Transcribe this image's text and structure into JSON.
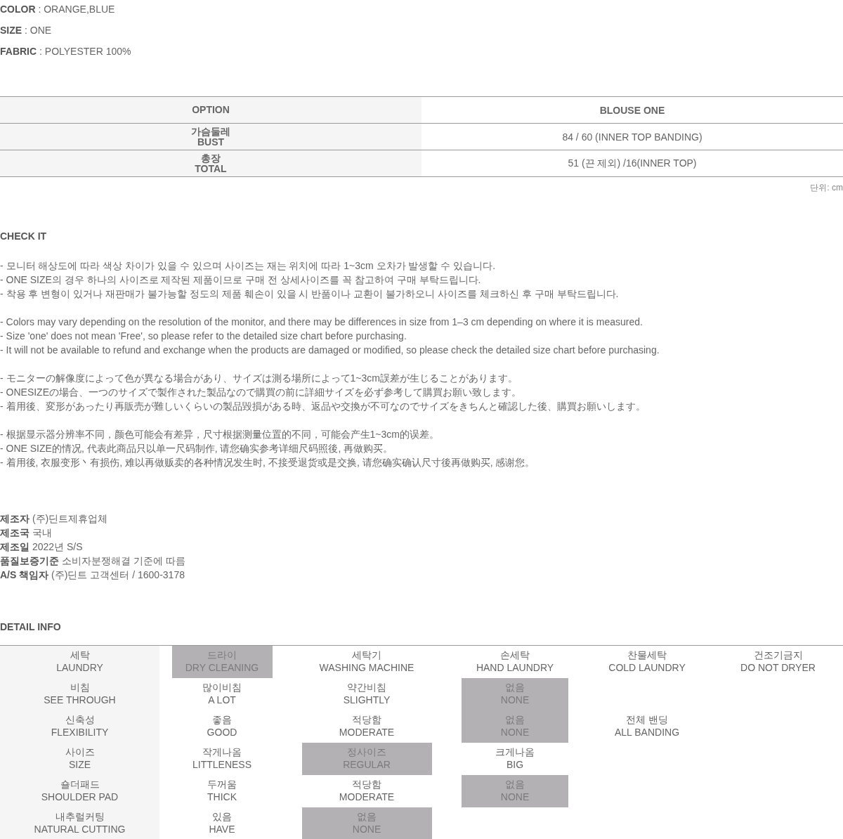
{
  "specs": [
    {
      "label": "COLOR",
      "value": ": ORANGE,BLUE"
    },
    {
      "label": "SIZE",
      "value": ": ONE"
    },
    {
      "label": "FABRIC",
      "value": ": POLYESTER 100%"
    }
  ],
  "size_table": {
    "columns": [
      "OPTION",
      "BLOUSE ONE"
    ],
    "rows": [
      {
        "ko": "가슴둘레",
        "en": "BUST",
        "value": "84 / 60 (INNER TOP BANDING)"
      },
      {
        "ko": "총장",
        "en": "TOTAL",
        "value": "51 (끈 제외) /16(INNER TOP)"
      }
    ],
    "unit": "단위: cm"
  },
  "check_it": {
    "title": "CHECK IT",
    "groups": [
      [
        "- 모니터 해상도에 따라 색상 차이가 있을 수 있으며 사이즈는 재는 위치에 따라 1~3cm 오차가 발생할 수 있습니다.",
        "- ONE SIZE의 경우 하나의 사이즈로 제작된 제품이므로 구매 전 상세사이즈를 꼭 참고하여 구매 부탁드립니다.",
        "- 착용 후 변형이 있거나 재판매가 불가능할 정도의 제품 훼손이 있을 시 반품이나 교환이 불가하오니 사이즈를 체크하신 후 구매 부탁드립니다."
      ],
      [
        "- Colors may vary depending on the resolution of the monitor, and there may be differences in size from 1–3 cm depending on where it is measured.",
        "- Size 'one' does not mean 'Free', so please refer to the detailed size chart before purchasing.",
        "- It will not be available to refund and exchange when the products are damaged or modified, so please check the detailed size chart before purchasing."
      ],
      [
        "- モニターの解像度によって色が異なる場合があり、サイズは測る場所によって1~3cm誤差が生じることがあります。",
        "- ONESIZEの場合、一つのサイズで製作された製品なので購買の前に詳細サイズを必ず参考して購買お願い致します。",
        "- 着用後、変形があったり再販売が難しいくらいの製品毀損がある時、返品や交換が不可なのでサイズをきちんと確認した後、購買お願いします。"
      ],
      [
        "- 根据显示器分辨率不同，颜色可能会有差异，尺寸根据测量位置的不同，可能会产生1~3cm的误差。",
        "- ONE SIZE的情况, 代表此商品只以单一尺码制作, 请您确实参考详细尺码照後, 再做购买。",
        "- 着用後, 衣服变形丶有损伤, 难以再做贩卖的各种情况发生时, 不接受退货或是交换, 请您确实确认尺寸後再做购买, 感谢您。"
      ]
    ]
  },
  "maker_info": [
    {
      "label": "제조자",
      "value": "(주)딘트제휴업체"
    },
    {
      "label": "제조국",
      "value": "국내"
    },
    {
      "label": "제조일",
      "value": "2022년 S/S"
    },
    {
      "label": "품질보증기준",
      "value": "소비자분쟁해결 기준에 따름"
    },
    {
      "label": "A/S 책임자",
      "value": "(주)딘트 고객센터 / 1600-3178"
    }
  ],
  "detail_info": {
    "title": "DETAIL INFO",
    "rows": [
      {
        "ko": "세탁",
        "en": "LAUNDRY",
        "options": [
          {
            "ko": "드라이",
            "en": "DRY CLEANING",
            "selected": true
          },
          {
            "ko": "세탁기",
            "en": "WASHING MACHINE",
            "selected": false
          },
          {
            "ko": "손세탁",
            "en": "HAND LAUNDRY",
            "selected": false
          },
          {
            "ko": "찬물세탁",
            "en": "COLD LAUNDRY",
            "selected": false
          },
          {
            "ko": "건조기금지",
            "en": "DO NOT DRYER",
            "selected": false
          }
        ]
      },
      {
        "ko": "비침",
        "en": "SEE THROUGH",
        "options": [
          {
            "ko": "많이비침",
            "en": "A LOT",
            "selected": false
          },
          {
            "ko": "약간비침",
            "en": "SLIGHTLY",
            "selected": false
          },
          {
            "ko": "없음",
            "en": "NONE",
            "selected": true
          }
        ]
      },
      {
        "ko": "신축성",
        "en": "FLEXIBILITY",
        "options": [
          {
            "ko": "좋음",
            "en": "GOOD",
            "selected": false
          },
          {
            "ko": "적당함",
            "en": "MODERATE",
            "selected": false
          },
          {
            "ko": "없음",
            "en": "NONE",
            "selected": true
          },
          {
            "ko": "전체 밴딩",
            "en": "ALL BANDING",
            "selected": false
          }
        ]
      },
      {
        "ko": "사이즈",
        "en": "SIZE",
        "options": [
          {
            "ko": "작게나옴",
            "en": "LITTLENESS",
            "selected": false
          },
          {
            "ko": "정사이즈",
            "en": "REGULAR",
            "selected": true
          },
          {
            "ko": "크게나옴",
            "en": "BIG",
            "selected": false
          }
        ]
      },
      {
        "ko": "숄더패드",
        "en": "SHOULDER PAD",
        "options": [
          {
            "ko": "두꺼움",
            "en": "THICK",
            "selected": false
          },
          {
            "ko": "적당함",
            "en": "MODERATE",
            "selected": false
          },
          {
            "ko": "없음",
            "en": "NONE",
            "selected": true
          }
        ]
      },
      {
        "ko": "내추럴커팅",
        "en": "NATURAL CUTTING",
        "options": [
          {
            "ko": "있음",
            "en": "HAVE",
            "selected": false
          },
          {
            "ko": "없음",
            "en": "NONE",
            "selected": true
          }
        ]
      }
    ]
  }
}
